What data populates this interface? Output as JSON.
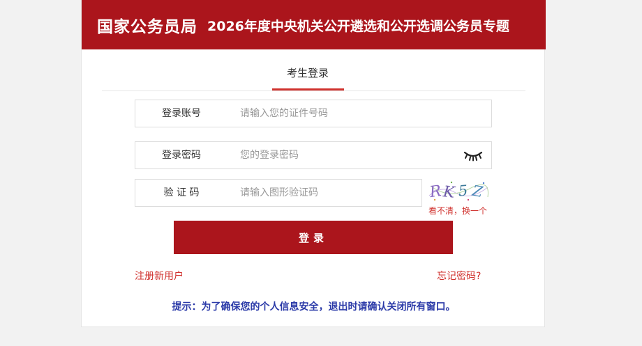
{
  "header": {
    "brand": "国家公务员局",
    "subtitle": "2026年度中央机关公开遴选和公开选调公务员专题"
  },
  "tabs": {
    "active_label": "考生登录"
  },
  "form": {
    "account": {
      "label": "登录账号",
      "placeholder": "请输入您的证件号码"
    },
    "password": {
      "label": "登录密码",
      "placeholder": "您的登录密码",
      "toggle_icon": "eye-closed-icon"
    },
    "captcha": {
      "label": "验 证 码",
      "placeholder": "请输入图形验证码",
      "image_text": "RK5Z",
      "refresh_label": "看不清，换一个"
    }
  },
  "login_button_label": "登录",
  "links": {
    "register": "注册新用户",
    "forgot": "忘记密码?"
  },
  "tip": "提示：为了确保您的个人信息安全，退出时请确认关闭所有窗口。",
  "colors": {
    "brand_red": "#ab151c",
    "accent_red": "#d0312d",
    "tip_blue": "#2b3aa8"
  }
}
